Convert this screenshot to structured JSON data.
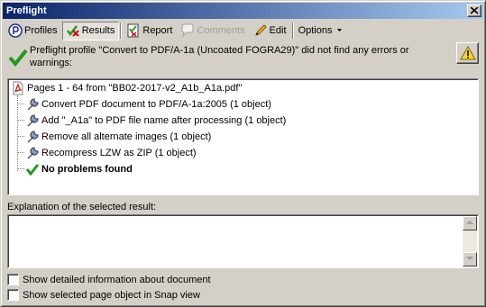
{
  "window": {
    "title": "Preflight"
  },
  "toolbar": {
    "profiles": "Profiles",
    "results": "Results",
    "report": "Report",
    "comments": "Comments",
    "edit": "Edit",
    "options": "Options"
  },
  "summary": {
    "message": "Preflight profile \"Convert to PDF/A-1a (Uncoated FOGRA29)\" did not find any errors or warnings:"
  },
  "tree": {
    "root": "Pages 1 - 64 from \"BB02-2017-v2_A1b_A1a.pdf\"",
    "items": [
      "Convert PDF document to PDF/A-1a:2005 (1 object)",
      "Add \"_A1a\" to PDF file name after processing (1 object)",
      "Remove all alternate images (1 object)",
      "Recompress LZW as ZIP  (1 object)"
    ],
    "result": "No problems found"
  },
  "explanation": {
    "label": "Explanation of the selected result:",
    "value": ""
  },
  "options": {
    "detailed_info": "Show detailed information about document",
    "snap_view": "Show selected page object in Snap view"
  },
  "colors": {
    "title_start": "#0a246a",
    "title_end": "#a6caf0",
    "ok_green": "#1e9a1e"
  }
}
